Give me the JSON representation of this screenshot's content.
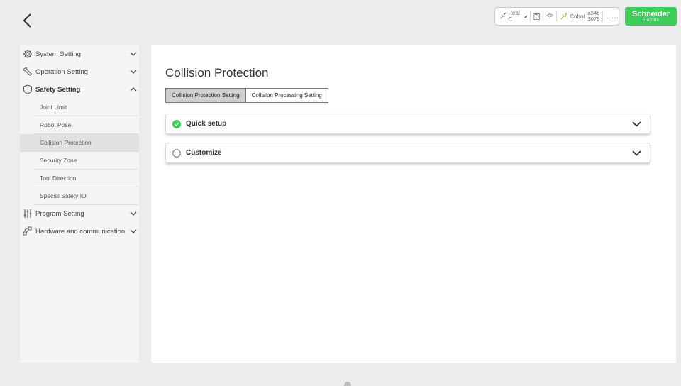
{
  "status_bar": {
    "robot_mode": "Real C",
    "cobot_label": "Cobot",
    "cobot_id_line1": "a54b",
    "cobot_id_line2": "3079",
    "more": "..."
  },
  "brand": {
    "name": "Schneider",
    "sub": "Electric",
    "color": "#3dcd58"
  },
  "sidebar": {
    "system_setting": "System Setting",
    "operation_setting": "Operation Setting",
    "safety_setting": "Safety Setting",
    "safety_items": [
      "Joint Limit",
      "Robot Pose",
      "Collision Protection",
      "Security Zone",
      "Tool Direction",
      "Special Safety IO"
    ],
    "program_setting": "Program Setting",
    "hardware_communication": "Hardware and communication"
  },
  "main": {
    "title": "Collision Protection",
    "tabs": [
      "Collision Protection Setting",
      "Collision Processing Setting"
    ],
    "panels": {
      "quick_setup": "Quick setup",
      "customize": "Customize"
    }
  }
}
